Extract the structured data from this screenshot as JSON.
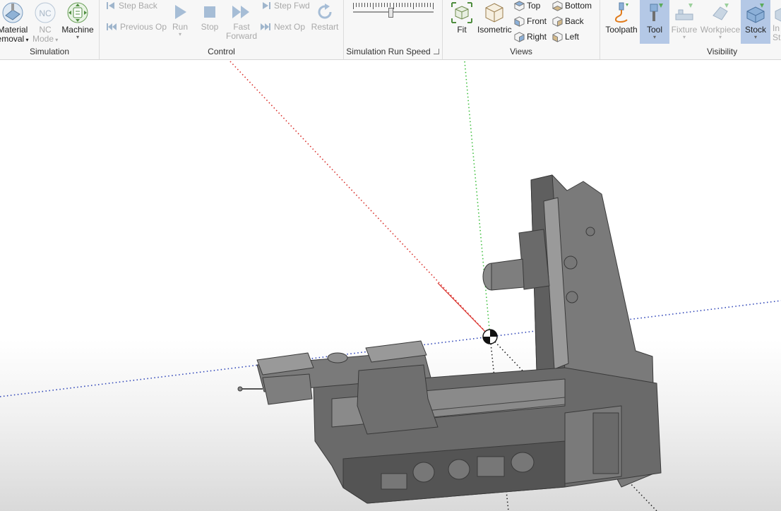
{
  "ribbon": {
    "simulation": {
      "label": "Simulation",
      "material_removal": {
        "line1": "Material",
        "line2": "emoval"
      },
      "nc_mode": {
        "icon_text": "NC",
        "line1": "NC",
        "line2": "Mode"
      },
      "machine": {
        "label": "Machine"
      }
    },
    "control": {
      "label": "Control",
      "step_back": "Step Back",
      "previous_op": "Previous Op",
      "run": "Run",
      "stop": "Stop",
      "fast_forward": {
        "line1": "Fast",
        "line2": "Forward"
      },
      "step_fwd": "Step Fwd",
      "next_op": "Next Op",
      "restart": "Restart"
    },
    "speed": {
      "label": "Simulation Run Speed",
      "level": 0.47
    },
    "views": {
      "label": "Views",
      "fit": "Fit",
      "isometric": "Isometric",
      "top": "Top",
      "front": "Front",
      "right": "Right",
      "bottom": "Bottom",
      "back": "Back",
      "left": "Left"
    },
    "visibility": {
      "label": "Visibility",
      "toolpath": "Toolpath",
      "tool": "Tool",
      "fixture": "Fixture",
      "workpiece": "Workpiece",
      "stock": "Stock",
      "partial_next": {
        "line1": "In",
        "line2": "St"
      }
    }
  },
  "colors": {
    "ribbon_bg": "#f7f7f7",
    "active_toggle": "#b4c8e6",
    "disabled_text": "#a9a9a9",
    "axis_x": "#d9302b",
    "axis_y": "#3fbf3f",
    "axis_z": "#3046b8",
    "machine_body": "#727272"
  }
}
